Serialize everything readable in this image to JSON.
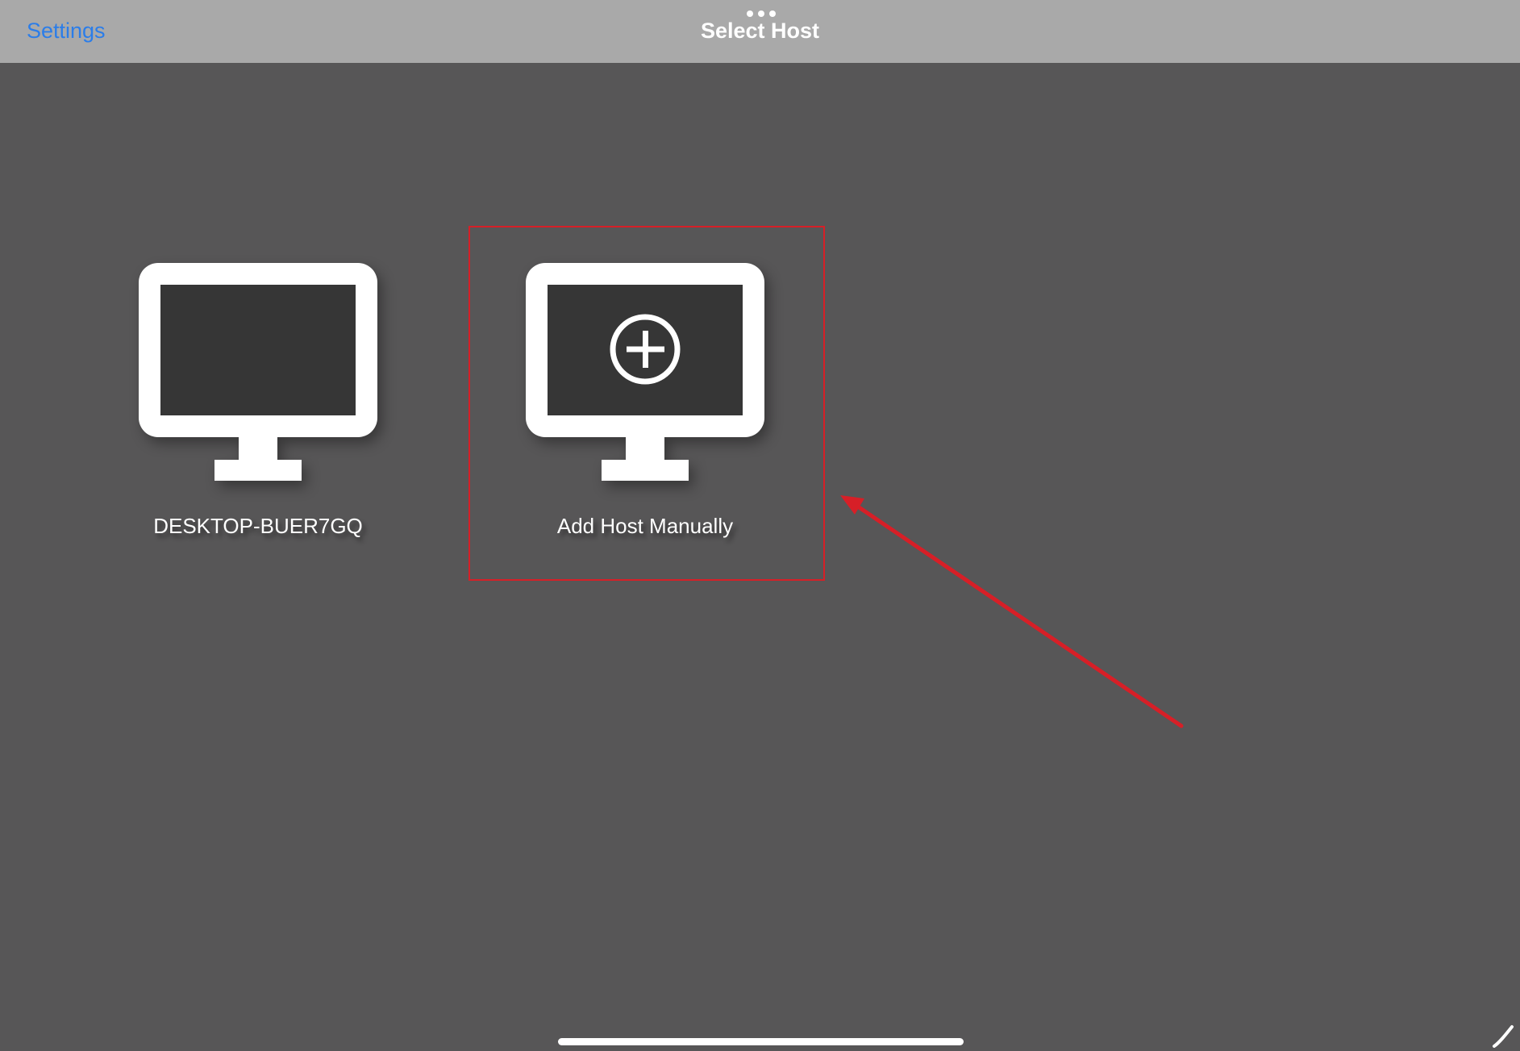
{
  "nav": {
    "back_label": "Settings",
    "title": "Select Host"
  },
  "hosts": [
    {
      "label": "DESKTOP-BUER7GQ",
      "icon": "monitor-icon"
    },
    {
      "label": "Add Host Manually",
      "icon": "monitor-add-icon"
    }
  ],
  "colors": {
    "background": "#575657",
    "nav_bar": "#a9a9a9",
    "link": "#2b7de9",
    "annotation": "#d71f27",
    "monitor_screen": "#363636"
  },
  "annotations": {
    "highlight_target": "Add Host Manually",
    "arrow": "red arrow pointing to highlighted tile"
  }
}
